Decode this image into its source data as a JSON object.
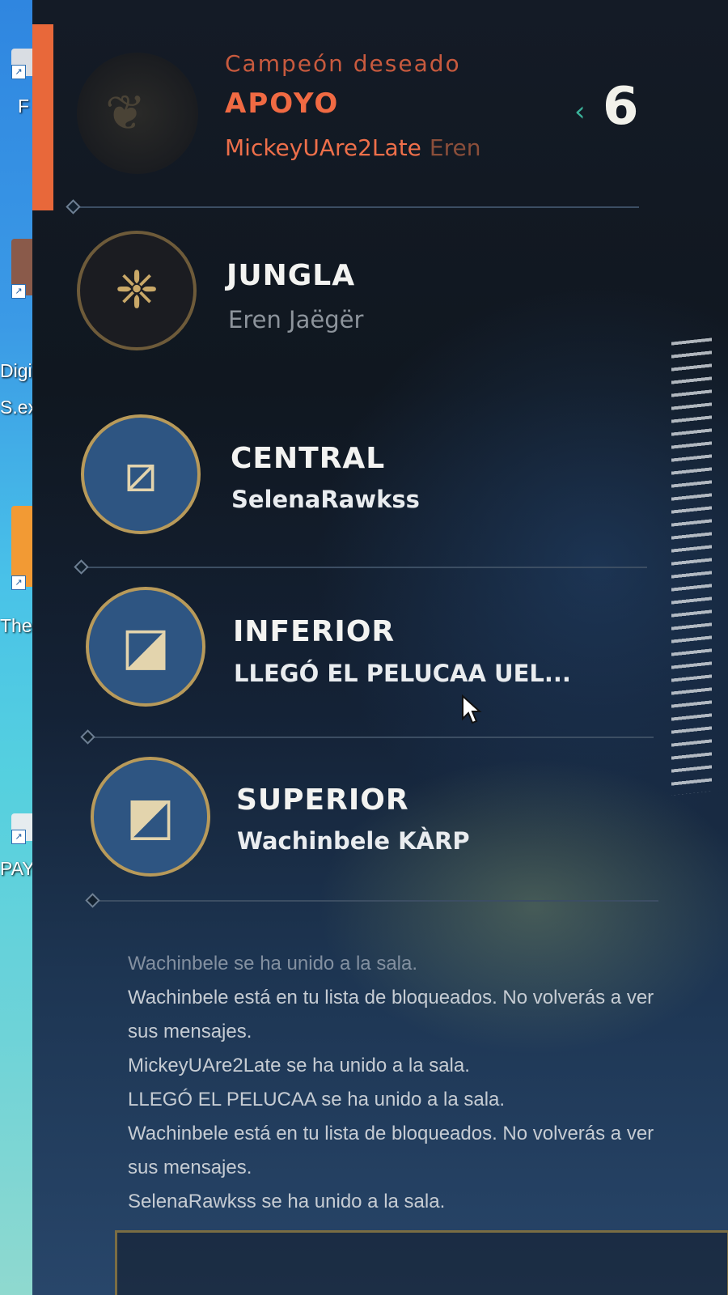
{
  "desktop": {
    "labels": [
      "F",
      "Digi",
      "S.ex",
      "The",
      "PAYD"
    ]
  },
  "header": {
    "subtitle": "Campeón deseado",
    "role": "APOYO",
    "player": "MickeyUAre2Late",
    "player_alt": "Eren",
    "timer": "6"
  },
  "slots": [
    {
      "role": "JUNGLA",
      "player": "Eren Jaëgër",
      "icon": "jungle-icon"
    },
    {
      "role": "CENTRAL",
      "player": "SelenaRawkss",
      "icon": "mid-lane-icon"
    },
    {
      "role": "INFERIOR",
      "player": "LLEGÓ EL PELUCAA UEL...",
      "icon": "bottom-lane-icon"
    },
    {
      "role": "SUPERIOR",
      "player": "Wachinbele KÀRP",
      "icon": "top-lane-icon"
    }
  ],
  "chat": [
    "Wachinbele se ha unido a la sala.",
    "Wachinbele está en tu lista de bloqueados. No volverás a ver sus mensajes.",
    "MickeyUAre2Late se ha unido a la sala.",
    "LLEGÓ EL PELUCAA se ha unido a la sala.",
    "Wachinbele está en tu lista de bloqueados. No volverás a ver sus mensajes.",
    "SelenaRawkss se ha unido a la sala."
  ],
  "colors": {
    "accent_orange": "#e8683a",
    "gold_ring": "#b89a5a",
    "timer_arrow": "#3bb39a"
  }
}
